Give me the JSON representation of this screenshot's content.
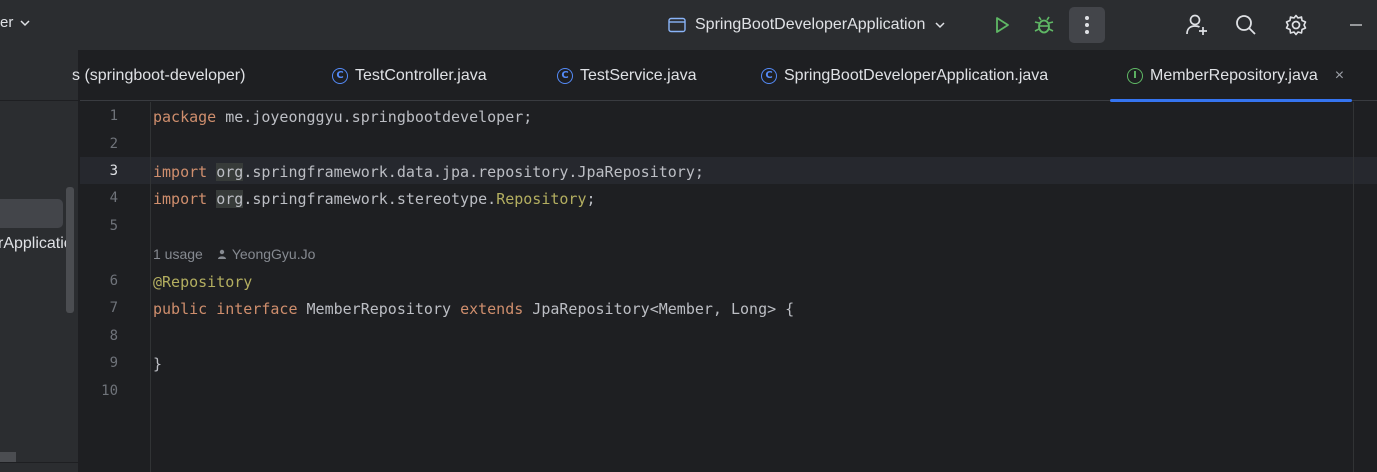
{
  "titlebar": {
    "project_name": "er",
    "run_config": "SpringBootDeveloperApplication"
  },
  "left_panel": {
    "visible_text": "rApplicatio"
  },
  "tabs": [
    {
      "label": "s (springboot-developer)",
      "kind": "none"
    },
    {
      "label": "TestController.java",
      "kind": "class"
    },
    {
      "label": "TestService.java",
      "kind": "class"
    },
    {
      "label": "SpringBootDeveloperApplication.java",
      "kind": "class"
    },
    {
      "label": "MemberRepository.java",
      "kind": "interface",
      "active": true
    }
  ],
  "tab_icons": {
    "class": "C",
    "interface": "I",
    "close": "×"
  },
  "editor": {
    "line_numbers": [
      "1",
      "2",
      "3",
      "4",
      "5",
      "6",
      "7",
      "8",
      "9",
      "10"
    ],
    "current_line": "3",
    "inlay_hint": {
      "usages": "1 usage",
      "author": "YeongGyu.Jo"
    },
    "code": {
      "l1_kw": "package",
      "l1_rest": " me.joyeonggyu.springbootdeveloper;",
      "l3_kw": "import",
      "l3_org": "org",
      "l3_rest": ".springframework.data.jpa.repository.JpaRepository;",
      "l4_kw": "import",
      "l4_org": "org",
      "l4_mid": ".springframework.stereotype.",
      "l4_ann": "Repository",
      "l4_end": ";",
      "l6_ann": "@Repository",
      "l7_kw1": "public",
      "l7_kw2": "interface",
      "l7_name": " MemberRepository ",
      "l7_kw3": "extends",
      "l7_rest": " JpaRepository<Member, Long> {",
      "l9": "}"
    }
  },
  "colors": {
    "keyword": "#cf8e6d",
    "annotation": "#b3ae60",
    "text": "#bcbec4",
    "accent": "#3574f0"
  }
}
